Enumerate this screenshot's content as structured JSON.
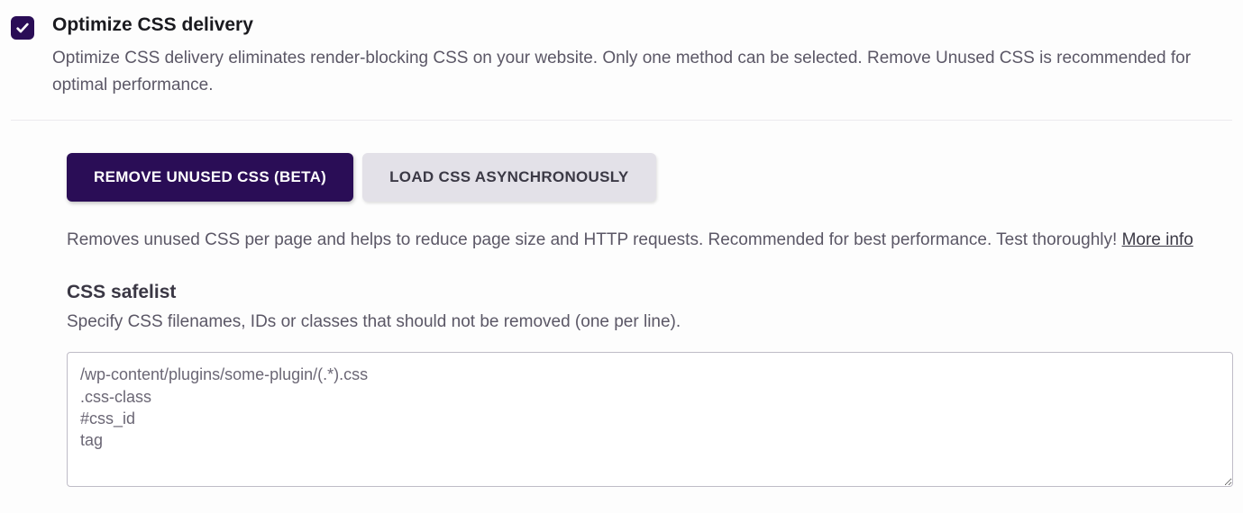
{
  "header": {
    "title": "Optimize CSS delivery",
    "description": "Optimize CSS delivery eliminates render-blocking CSS on your website. Only one method can be selected. Remove Unused CSS is recommended for optimal performance.",
    "checked": true
  },
  "tabs": {
    "remove_unused": "REMOVE UNUSED CSS (BETA)",
    "load_async": "LOAD CSS ASYNCHRONOUSLY"
  },
  "tab_panel": {
    "description": "Removes unused CSS per page and helps to reduce page size and HTTP requests. Recommended for best performance. Test thoroughly! ",
    "more_info": "More info"
  },
  "safelist": {
    "title": "CSS safelist",
    "description": "Specify CSS filenames, IDs or classes that should not be removed (one per line).",
    "placeholder": "/wp-content/plugins/some-plugin/(.*).css\n.css-class\n#css_id\ntag"
  }
}
